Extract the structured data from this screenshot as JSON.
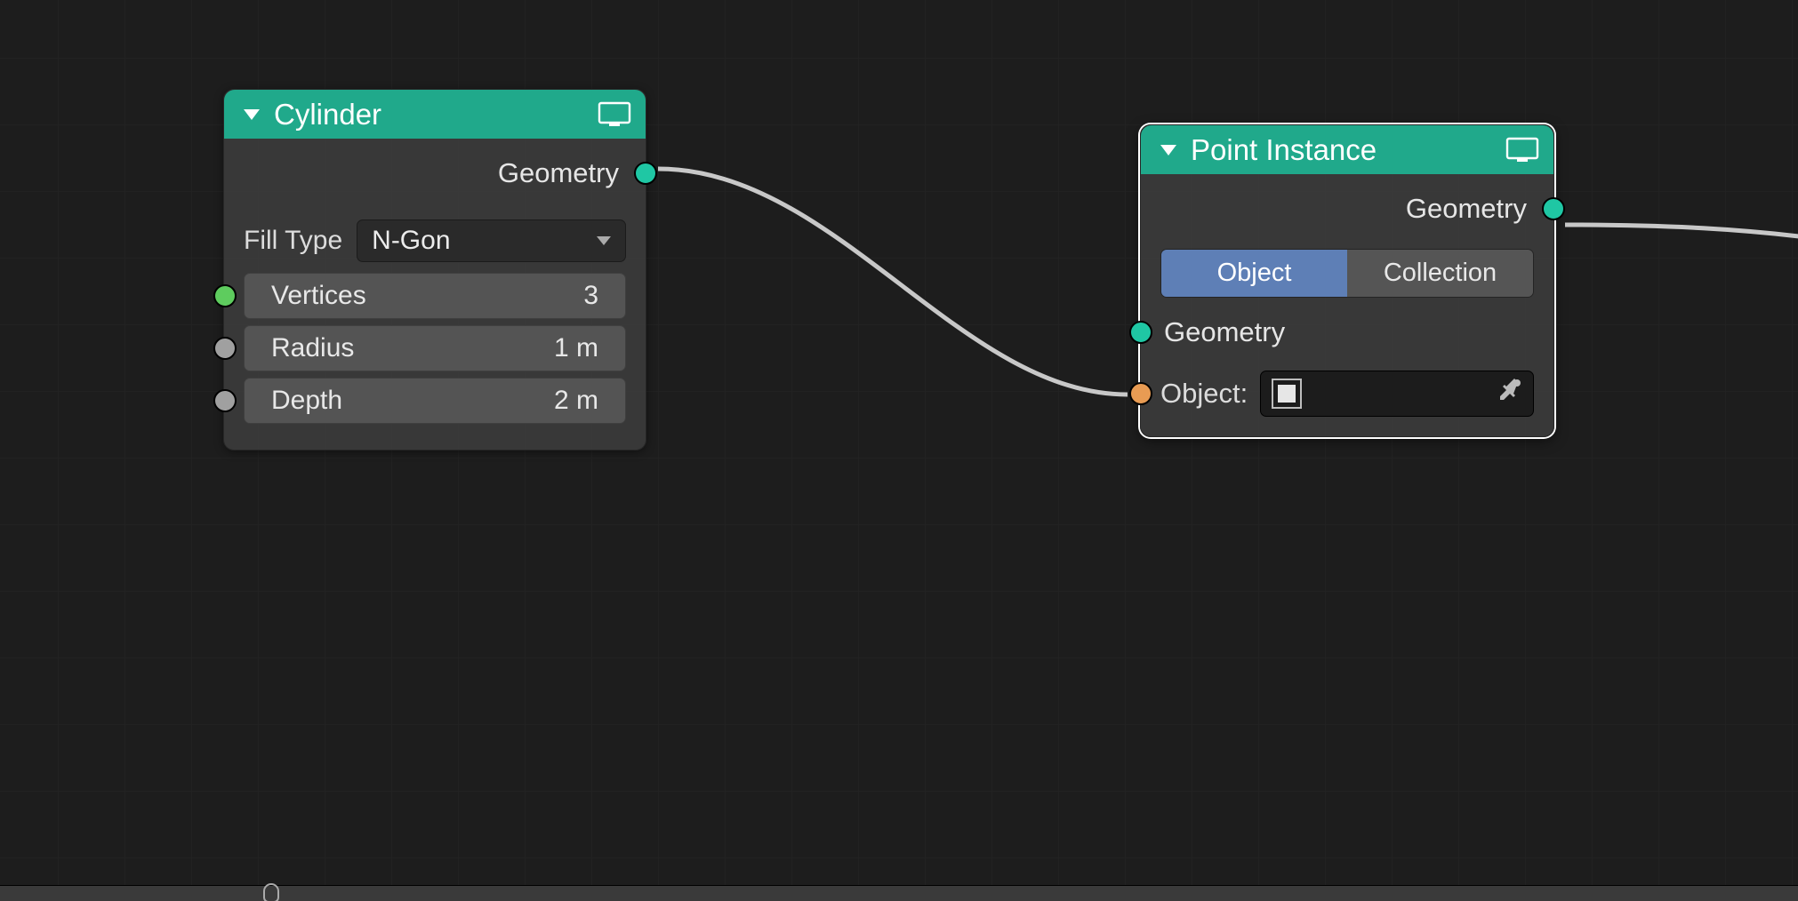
{
  "nodes": {
    "cylinder": {
      "title": "Cylinder",
      "out_geometry": "Geometry",
      "fill_label": "Fill Type",
      "fill_value": "N-Gon",
      "vertices_label": "Vertices",
      "vertices_value": "3",
      "radius_label": "Radius",
      "radius_value": "1 m",
      "depth_label": "Depth",
      "depth_value": "2 m"
    },
    "pointinstance": {
      "title": "Point Instance",
      "out_geometry": "Geometry",
      "mode_object": "Object",
      "mode_collection": "Collection",
      "in_geometry": "Geometry",
      "object_label": "Object:"
    }
  }
}
